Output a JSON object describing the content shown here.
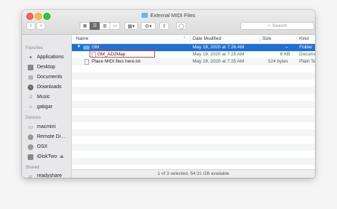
{
  "window": {
    "title": "External MIDI Files"
  },
  "toolbar": {
    "back": "‹",
    "forward": "›",
    "search_placeholder": "Search"
  },
  "sidebar": {
    "favorites_heading": "Favorites",
    "favorites": [
      {
        "label": "Applications",
        "icon": "applications-icon"
      },
      {
        "label": "Desktop",
        "icon": "desktop-icon"
      },
      {
        "label": "Documents",
        "icon": "documents-icon"
      },
      {
        "label": "Downloads",
        "icon": "downloads-icon"
      },
      {
        "label": "Music",
        "icon": "music-icon"
      },
      {
        "label": "gabgar",
        "icon": "home-icon"
      }
    ],
    "devices_heading": "Devices",
    "devices": [
      {
        "label": "macmini",
        "icon": "computer-icon"
      },
      {
        "label": "Remote Di…",
        "icon": "remote-disc-icon"
      },
      {
        "label": "OSX",
        "icon": "disk-icon"
      },
      {
        "label": "iDiskTwo",
        "icon": "disk-icon",
        "eject": "⏏"
      }
    ],
    "shared_heading": "Shared",
    "shared": [
      {
        "label": "readyshare",
        "icon": "network-icon"
      }
    ]
  },
  "columns": {
    "name": "Name",
    "date": "Date Modified",
    "size": "Size",
    "kind": "Kind"
  },
  "files": [
    {
      "name": "GM",
      "date": "May 19, 2020 at 7:26 AM",
      "size": "--",
      "kind": "Folder",
      "type": "folder",
      "selected": true
    },
    {
      "name": "GM_AD2Map",
      "date": "May 19, 2020 at 7:25 AM",
      "size": "8 KB",
      "kind": "Docume",
      "type": "file"
    },
    {
      "name": "Place MIDI files here.txt",
      "date": "May 19, 2020 at 7:25 AM",
      "size": "524 bytes",
      "kind": "Plain Te",
      "type": "file"
    }
  ],
  "status": {
    "text": "1 of 3 selected, 54.31 GB available"
  },
  "colors": {
    "selection": "#1f6fd5",
    "highlight_box": "#e03a2e",
    "folder": "#6cb6f0"
  }
}
